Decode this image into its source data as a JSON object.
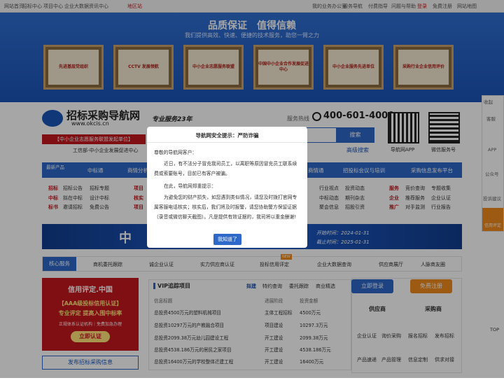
{
  "topbar": {
    "items": [
      "网站首页",
      "招标中心",
      "项目中心",
      "企业大数据",
      "资讯中心"
    ],
    "region": "地区站",
    "right": [
      "我的业务办公室",
      "服务导航",
      "付费指导",
      "问题与帮助",
      "登录",
      "免费注册",
      "网站地图"
    ]
  },
  "banner": {
    "title": "品质保证　值得信赖",
    "subtitle": "我们提供高效、快速、便捷的技术服务，助您一臂之力",
    "plaques": [
      "先进基层党组织",
      "CCTV 发展领航",
      "中小企业志愿服务联盟",
      "中国中小企业合作发展促进中心",
      "中小企业服务先进单位",
      "采购行业企业信用评价"
    ]
  },
  "brand": {
    "name": "招标采购导航网",
    "url": "www.okcis.cn",
    "service": "专业服务23年",
    "hotline_label": "服务热线",
    "hotline": "400-601-4000",
    "union": "【中小企业志愿服务联盟发起单位】",
    "promo": "工信部-中小企业发展促进中心",
    "search_button": "搜索",
    "advanced_search": "高级搜索",
    "qr1": "导航网APP",
    "qr2": "微信服务号"
  },
  "nav": {
    "all": "最新产品",
    "items": [
      "中标通",
      "商情分析",
      "招投标会议与培训",
      "采购信息发布平台"
    ],
    "hidden": "商情通"
  },
  "subnav": {
    "row1": [
      "招标",
      "招标公告",
      "招标专题",
      "项目",
      "行业视点",
      "投资动态",
      "服务",
      "竞价查询",
      "专题收集"
    ],
    "row2": [
      "中标",
      "拟在中标",
      "设计中标",
      "核实",
      "中标动态",
      "期刊杂志",
      "企业",
      "推荐服务",
      "企业认证"
    ],
    "row3": [
      "标书",
      "邀请招标",
      "免费公告",
      "项目",
      "聚会信息",
      "招股引资",
      "推广",
      "对手监测",
      "行业报告"
    ]
  },
  "ad": {
    "label": "中",
    "start": "开始时间：2024-01-31",
    "end": "截止时间：2025-01-31"
  },
  "services": {
    "label": "核心服务",
    "items": [
      "商机委托跟踪",
      "诚企业认证",
      "实力供应商认证",
      "投标信用评定",
      "企业大数据查询",
      "供应商展厅",
      "人脉商友圈"
    ],
    "badge": "NEW"
  },
  "credit": {
    "title": "信用评定.中国",
    "line1": "【AAA级投标信用认证】",
    "line2": "专业评定 提高入围中标率",
    "line3": "正规体系认证机构｜免费加急办理",
    "button": "立即认证",
    "publish": "发布招标采购信息"
  },
  "vip": {
    "title": "VIP追踪项目",
    "tabs": [
      "拟建",
      "特约查询",
      "委托跟踪",
      "商业精选"
    ],
    "headers": [
      "信息标题",
      "进展阶段",
      "投资金额"
    ],
    "rows": [
      [
        "总投资4500万元的塑料机械项目",
        "主体工程招标",
        "4500万元"
      ],
      [
        "总投资10297万元的产教融合项目",
        "项目建设",
        "10297.3万元"
      ],
      [
        "总投资2099.38万元幼儿园建设工程",
        "开工建设",
        "2099.38万元"
      ],
      [
        "总投资4538.186万元的居民之家项目",
        "开工建设",
        "4538.186万元"
      ],
      [
        "总投资16400万元的学校整体迁建工程",
        "开工建设",
        "16400万元"
      ]
    ]
  },
  "login": {
    "login_button": "立即登录",
    "register_button": "免费注册",
    "supplier": "供应商",
    "buyer": "采购商",
    "grid1": [
      "企业认证",
      "询价采购",
      "报名招标",
      "发布招标"
    ],
    "grid2": [
      "产品速递",
      "产品管理",
      "信息定制",
      "供求对接"
    ]
  },
  "sidebar": {
    "items": [
      "收起",
      "客服",
      "APP",
      "公众号",
      "投诉建议",
      "信用评定",
      "TOP"
    ],
    "badge": "NEW"
  },
  "modal": {
    "title": "导航网安全提示：严防诈骗",
    "greeting": "尊敬的导航网客户：",
    "p1": "近日，有不法分子冒充我司员工，以离职等原因冒充员工联系续费或索要账号，目前已有客户被骗。",
    "p2": "在此，导航网郑重提示：",
    "p3": "为避免您的财产损失，如您遇到类似情况，请您及时拨打官网专属客服电话核实；核实后，我们将及时报警，请您协助警方保留证据（录音或微信聊天截图）。凡是提供有效证据的，我司将以重金酬谢!",
    "button": "我知道了"
  },
  "colors": {
    "primary": "#2e68c9",
    "accent": "#c4171e",
    "orange": "#f08a1c"
  }
}
